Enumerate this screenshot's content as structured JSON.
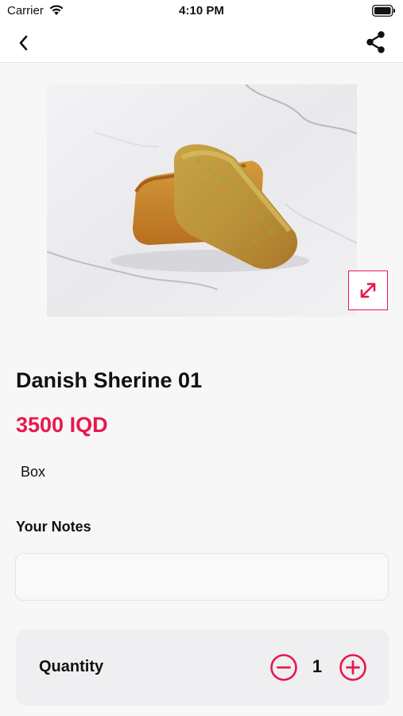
{
  "status_bar": {
    "carrier": "Carrier",
    "time": "4:10 PM",
    "icons": [
      "wifi-icon",
      "battery-icon"
    ]
  },
  "nav": {
    "back_icon": "chevron-left-icon",
    "share_icon": "share-icon"
  },
  "product": {
    "image_alt": "pastry-photo",
    "expand_icon": "expand-arrows-icon",
    "name": "Danish Sherine 01",
    "price": "3500 IQD",
    "unit": "Box"
  },
  "notes": {
    "label": "Your Notes",
    "value": "",
    "placeholder": ""
  },
  "quantity": {
    "label": "Quantity",
    "value": "1",
    "decrement_icon": "minus-circle-icon",
    "increment_icon": "plus-circle-icon"
  },
  "colors": {
    "accent": "#e8184a",
    "background": "#f7f7f8",
    "card": "#efeff1",
    "text": "#111111"
  }
}
